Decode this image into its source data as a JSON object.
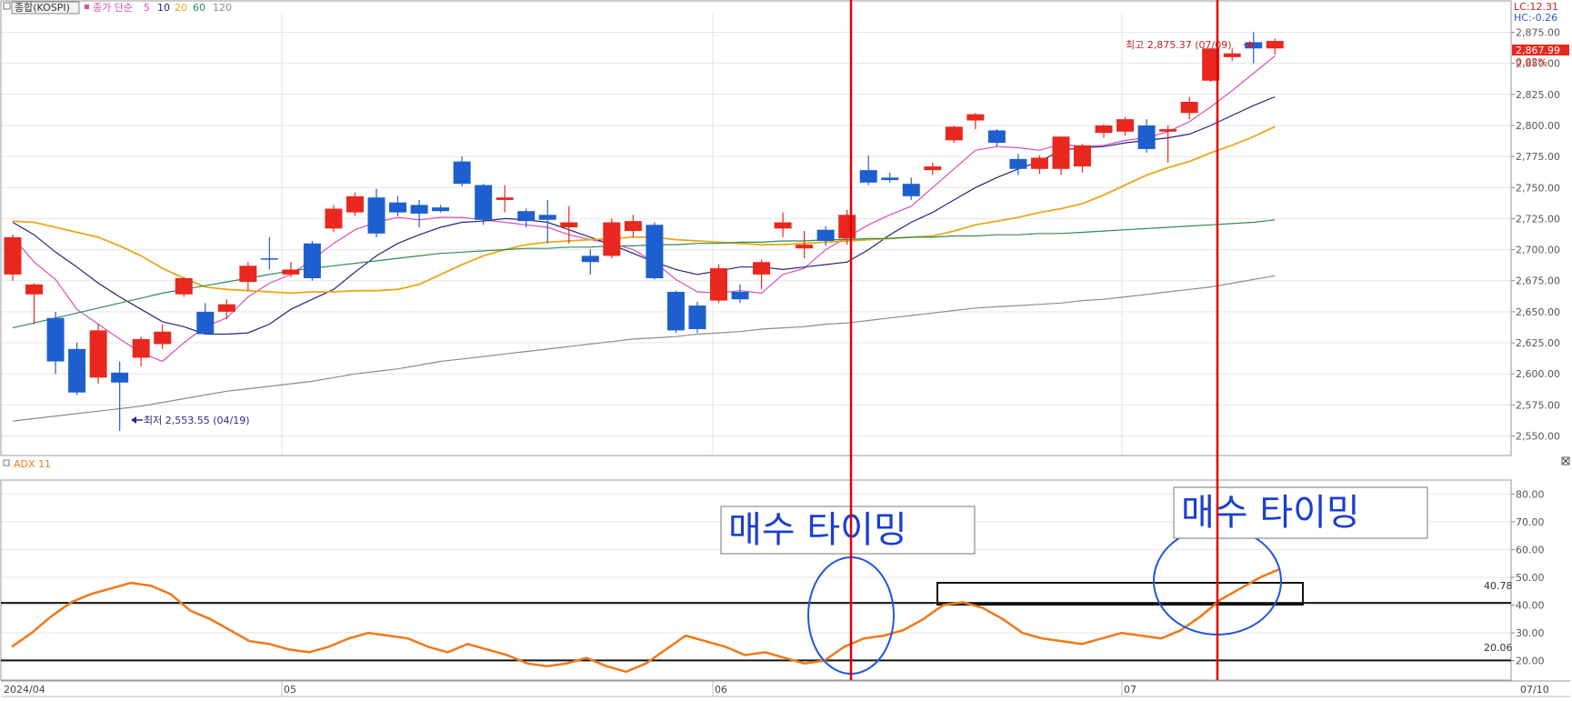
{
  "colors": {
    "up": "#e8281e",
    "down": "#1e5fcf",
    "ma5": "#d64fb7",
    "ma10": "#25257a",
    "ma20": "#e8a81c",
    "ma60": "#2e8b57",
    "ma120": "#8c8c8c",
    "adx": "#f07818",
    "marker_line": "#e00000",
    "circle": "#2255dd",
    "annotation_text": "#1a3fd0",
    "axis_text": "#555555",
    "grid": "#e6e6e6"
  },
  "price_panel": {
    "name_label": "종합(KOSPI)",
    "ma_title": "종가 단순",
    "ma_periods": [
      "5",
      "10",
      "20",
      "60",
      "120"
    ],
    "lc_label": "LC:12.31",
    "hc_label": "HC:-0.26",
    "current_price_label": "2,867.99",
    "change_pct_label": "0.02%",
    "high_annotation": "최고 2,875.37 (07/09)",
    "low_annotation": "최저 2,553.55 (04/19)",
    "y_ticks": [
      "2,875.00",
      "2,850.00",
      "2,825.00",
      "2,800.00",
      "2,775.00",
      "2,750.00",
      "2,725.00",
      "2,700.00",
      "2,675.00",
      "2,650.00",
      "2,625.00",
      "2,600.00",
      "2,575.00",
      "2,550.00"
    ]
  },
  "adx_panel": {
    "label": "ADX 11",
    "y_ticks": [
      "80.00",
      "70.00",
      "60.00",
      "50.00",
      "40.00",
      "30.00",
      "20.00"
    ],
    "upper_level_label": "40.78",
    "lower_level_label": "20.06",
    "annotation_1": "매수 타이밍",
    "annotation_2": "매수 타이밍"
  },
  "x_axis": {
    "labels": [
      "2024/04",
      "05",
      "06",
      "07"
    ],
    "right_label": "07/10"
  },
  "chart_data": [
    {
      "type": "candlestick",
      "title": "종합(KOSPI)",
      "ylim": [
        2535,
        2890
      ],
      "candles": [
        {
          "o": 2680,
          "h": 2712,
          "l": 2675,
          "c": 2710
        },
        {
          "o": 2664,
          "h": 2673,
          "l": 2640,
          "c": 2672
        },
        {
          "o": 2645,
          "h": 2650,
          "l": 2600,
          "c": 2610
        },
        {
          "o": 2620,
          "h": 2625,
          "l": 2583,
          "c": 2585
        },
        {
          "o": 2597,
          "h": 2640,
          "l": 2592,
          "c": 2635
        },
        {
          "o": 2601,
          "h": 2610,
          "l": 2554,
          "c": 2593
        },
        {
          "o": 2613,
          "h": 2630,
          "l": 2606,
          "c": 2628
        },
        {
          "o": 2624,
          "h": 2640,
          "l": 2620,
          "c": 2634
        },
        {
          "o": 2664,
          "h": 2678,
          "l": 2662,
          "c": 2677
        },
        {
          "o": 2650,
          "h": 2657,
          "l": 2632,
          "c": 2632
        },
        {
          "o": 2650,
          "h": 2660,
          "l": 2644,
          "c": 2656
        },
        {
          "o": 2674,
          "h": 2690,
          "l": 2667,
          "c": 2687
        },
        {
          "o": 2693,
          "h": 2710,
          "l": 2684,
          "c": 2692
        },
        {
          "o": 2680,
          "h": 2690,
          "l": 2678,
          "c": 2684
        },
        {
          "o": 2705,
          "h": 2707,
          "l": 2675,
          "c": 2677
        },
        {
          "o": 2717,
          "h": 2736,
          "l": 2714,
          "c": 2733
        },
        {
          "o": 2730,
          "h": 2746,
          "l": 2727,
          "c": 2743
        },
        {
          "o": 2742,
          "h": 2749,
          "l": 2710,
          "c": 2713
        },
        {
          "o": 2738,
          "h": 2743,
          "l": 2727,
          "c": 2730
        },
        {
          "o": 2736,
          "h": 2740,
          "l": 2718,
          "c": 2729
        },
        {
          "o": 2734,
          "h": 2736,
          "l": 2730,
          "c": 2731
        },
        {
          "o": 2771,
          "h": 2775,
          "l": 2751,
          "c": 2753
        },
        {
          "o": 2752,
          "h": 2753,
          "l": 2720,
          "c": 2724
        },
        {
          "o": 2740,
          "h": 2752,
          "l": 2730,
          "c": 2742
        },
        {
          "o": 2731,
          "h": 2733,
          "l": 2718,
          "c": 2723
        },
        {
          "o": 2728,
          "h": 2740,
          "l": 2705,
          "c": 2724
        },
        {
          "o": 2718,
          "h": 2735,
          "l": 2705,
          "c": 2722
        },
        {
          "o": 2695,
          "h": 2700,
          "l": 2680,
          "c": 2690
        },
        {
          "o": 2695,
          "h": 2725,
          "l": 2693,
          "c": 2722
        },
        {
          "o": 2715,
          "h": 2728,
          "l": 2710,
          "c": 2723
        },
        {
          "o": 2720,
          "h": 2722,
          "l": 2676,
          "c": 2677
        },
        {
          "o": 2666,
          "h": 2667,
          "l": 2633,
          "c": 2635
        },
        {
          "o": 2655,
          "h": 2658,
          "l": 2633,
          "c": 2636
        },
        {
          "o": 2659,
          "h": 2688,
          "l": 2657,
          "c": 2685
        },
        {
          "o": 2666,
          "h": 2672,
          "l": 2657,
          "c": 2660
        },
        {
          "o": 2680,
          "h": 2692,
          "l": 2668,
          "c": 2690
        },
        {
          "o": 2717,
          "h": 2730,
          "l": 2710,
          "c": 2722
        },
        {
          "o": 2701,
          "h": 2715,
          "l": 2693,
          "c": 2704
        },
        {
          "o": 2716,
          "h": 2719,
          "l": 2703,
          "c": 2707
        },
        {
          "o": 2709,
          "h": 2732,
          "l": 2704,
          "c": 2728
        },
        {
          "o": 2764,
          "h": 2776,
          "l": 2752,
          "c": 2754
        },
        {
          "o": 2758,
          "h": 2762,
          "l": 2754,
          "c": 2756
        },
        {
          "o": 2753,
          "h": 2758,
          "l": 2740,
          "c": 2743
        },
        {
          "o": 2764,
          "h": 2770,
          "l": 2760,
          "c": 2767
        },
        {
          "o": 2788,
          "h": 2800,
          "l": 2786,
          "c": 2799
        },
        {
          "o": 2804,
          "h": 2810,
          "l": 2797,
          "c": 2809
        },
        {
          "o": 2796,
          "h": 2797,
          "l": 2783,
          "c": 2786
        },
        {
          "o": 2773,
          "h": 2777,
          "l": 2760,
          "c": 2765
        },
        {
          "o": 2765,
          "h": 2776,
          "l": 2761,
          "c": 2774
        },
        {
          "o": 2765,
          "h": 2791,
          "l": 2760,
          "c": 2791
        },
        {
          "o": 2767,
          "h": 2785,
          "l": 2762,
          "c": 2784
        },
        {
          "o": 2794,
          "h": 2801,
          "l": 2790,
          "c": 2800
        },
        {
          "o": 2795,
          "h": 2807,
          "l": 2792,
          "c": 2805
        },
        {
          "o": 2800,
          "h": 2805,
          "l": 2778,
          "c": 2781
        },
        {
          "o": 2795,
          "h": 2800,
          "l": 2770,
          "c": 2797
        },
        {
          "o": 2810,
          "h": 2823,
          "l": 2805,
          "c": 2819
        },
        {
          "o": 2836,
          "h": 2862,
          "l": 2835,
          "c": 2862
        },
        {
          "o": 2855,
          "h": 2862,
          "l": 2852,
          "c": 2858
        },
        {
          "o": 2867,
          "h": 2875,
          "l": 2850,
          "c": 2862
        },
        {
          "o": 2862,
          "h": 2870,
          "l": 2857,
          "c": 2868
        }
      ],
      "moving_averages": [
        {
          "name": "5",
          "values": [
            2710,
            2690,
            2676,
            2652,
            2640,
            2628,
            2617,
            2610,
            2625,
            2638,
            2645,
            2662,
            2673,
            2680,
            2692,
            2705,
            2716,
            2722,
            2726,
            2724,
            2726,
            2726,
            2724,
            2722,
            2720,
            2718,
            2712,
            2708,
            2705,
            2700,
            2690,
            2676,
            2666,
            2665,
            2667,
            2665,
            2680,
            2685,
            2700,
            2710,
            2720,
            2728,
            2735,
            2750,
            2765,
            2780,
            2783,
            2782,
            2780,
            2785,
            2783,
            2784,
            2788,
            2790,
            2795,
            2803,
            2815,
            2828,
            2842,
            2856
          ]
        },
        {
          "name": "10",
          "values": [
            2722,
            2712,
            2698,
            2686,
            2673,
            2662,
            2652,
            2642,
            2638,
            2632,
            2632,
            2633,
            2640,
            2652,
            2660,
            2668,
            2682,
            2695,
            2705,
            2712,
            2718,
            2722,
            2723,
            2725,
            2724,
            2722,
            2716,
            2710,
            2704,
            2697,
            2690,
            2684,
            2680,
            2683,
            2686,
            2686,
            2684,
            2686,
            2688,
            2690,
            2700,
            2712,
            2722,
            2730,
            2740,
            2750,
            2758,
            2765,
            2771,
            2780,
            2782,
            2783,
            2786,
            2788,
            2790,
            2793,
            2800,
            2808,
            2816,
            2823
          ]
        },
        {
          "name": "20",
          "values": [
            2723,
            2722,
            2718,
            2714,
            2710,
            2703,
            2695,
            2685,
            2677,
            2670,
            2668,
            2667,
            2666,
            2665,
            2666,
            2666,
            2667,
            2667,
            2668,
            2672,
            2680,
            2688,
            2695,
            2700,
            2704,
            2706,
            2707,
            2708,
            2709,
            2710,
            2710,
            2708,
            2707,
            2706,
            2705,
            2704,
            2704,
            2705,
            2706,
            2707,
            2708,
            2709,
            2710,
            2711,
            2715,
            2720,
            2723,
            2726,
            2730,
            2733,
            2737,
            2744,
            2752,
            2760,
            2766,
            2771,
            2778,
            2784,
            2791,
            2799
          ]
        },
        {
          "name": "60",
          "values": [
            2637,
            2641,
            2645,
            2649,
            2653,
            2657,
            2661,
            2665,
            2668,
            2671,
            2674,
            2677,
            2680,
            2683,
            2685,
            2687,
            2689,
            2691,
            2693,
            2695,
            2697,
            2698,
            2699,
            2700,
            2701,
            2701,
            2702,
            2702,
            2703,
            2703,
            2704,
            2704,
            2705,
            2705,
            2706,
            2706,
            2707,
            2707,
            2708,
            2708,
            2709,
            2709,
            2710,
            2710,
            2711,
            2711,
            2712,
            2712,
            2713,
            2713,
            2714,
            2715,
            2716,
            2717,
            2718,
            2719,
            2720,
            2721,
            2722,
            2724
          ]
        },
        {
          "name": "120",
          "values": [
            2562,
            2564,
            2566,
            2568,
            2570,
            2572,
            2574,
            2577,
            2580,
            2583,
            2586,
            2588,
            2590,
            2592,
            2594,
            2597,
            2600,
            2602,
            2604,
            2607,
            2610,
            2612,
            2614,
            2616,
            2618,
            2620,
            2622,
            2624,
            2626,
            2628,
            2629,
            2630,
            2632,
            2633,
            2634,
            2636,
            2637,
            2638,
            2640,
            2641,
            2643,
            2645,
            2647,
            2649,
            2651,
            2653,
            2654,
            2655,
            2656,
            2657,
            2659,
            2660,
            2662,
            2664,
            2666,
            2668,
            2670,
            2673,
            2676,
            2679
          ]
        }
      ]
    },
    {
      "type": "line",
      "title": "ADX 11",
      "ylim": [
        13,
        85
      ],
      "series": [
        {
          "name": "ADX 11",
          "values": [
            25,
            30,
            36,
            41,
            44,
            46,
            48,
            47,
            44,
            38,
            35,
            31,
            27,
            26,
            24,
            23,
            25,
            28,
            30,
            29,
            28,
            25,
            23,
            26,
            24,
            22,
            19,
            18,
            19,
            21,
            18,
            16,
            19,
            24,
            29,
            27,
            25,
            22,
            23,
            21,
            19,
            20,
            25,
            28,
            29,
            31,
            35,
            40,
            41,
            39,
            35,
            30,
            28,
            27,
            26,
            28,
            30,
            29,
            28,
            31,
            36,
            42,
            46,
            50,
            53
          ]
        }
      ],
      "levels": [
        40.78,
        20.06
      ]
    }
  ]
}
